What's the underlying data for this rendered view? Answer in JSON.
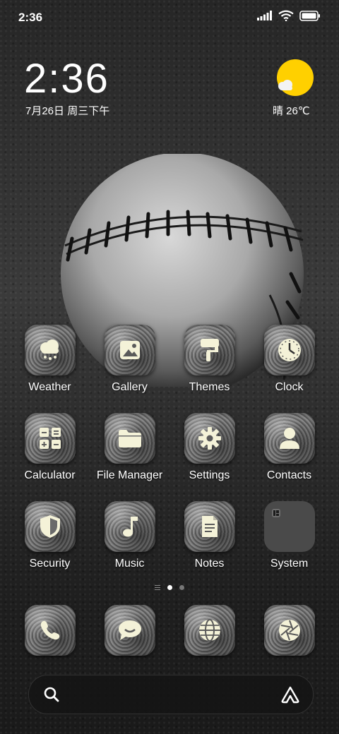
{
  "status_bar": {
    "time": "2:36",
    "icons": [
      "signal-icon",
      "wifi-icon",
      "battery-icon"
    ]
  },
  "clock_widget": {
    "time": "2:36",
    "date": "7月26日 周三下午"
  },
  "weather_widget": {
    "text": "晴 26℃",
    "icon": "sunny-cloud-icon",
    "sun_color": "#ffd000"
  },
  "apps": [
    {
      "label": "Weather",
      "icon": "weather-icon"
    },
    {
      "label": "Gallery",
      "icon": "gallery-icon"
    },
    {
      "label": "Themes",
      "icon": "themes-icon"
    },
    {
      "label": "Clock",
      "icon": "clock-icon"
    },
    {
      "label": "Calculator",
      "icon": "calculator-icon"
    },
    {
      "label": "File Manager",
      "icon": "folder-icon"
    },
    {
      "label": "Settings",
      "icon": "gear-icon"
    },
    {
      "label": "Contacts",
      "icon": "contacts-icon"
    },
    {
      "label": "Security",
      "icon": "shield-icon"
    },
    {
      "label": "Music",
      "icon": "music-note-icon"
    },
    {
      "label": "Notes",
      "icon": "notes-icon"
    },
    {
      "label": "System",
      "icon": "folder-system-icon"
    }
  ],
  "pager": {
    "pages": 2,
    "active": 1
  },
  "dock": [
    {
      "icon": "phone-icon"
    },
    {
      "icon": "message-icon"
    },
    {
      "icon": "browser-icon"
    },
    {
      "icon": "camera-icon"
    }
  ],
  "search_bar": {
    "icons": [
      "search-icon",
      "assistant-icon"
    ]
  },
  "colors": {
    "icon_glyph": "#f4f2d8",
    "accent_sun": "#ffd000"
  }
}
